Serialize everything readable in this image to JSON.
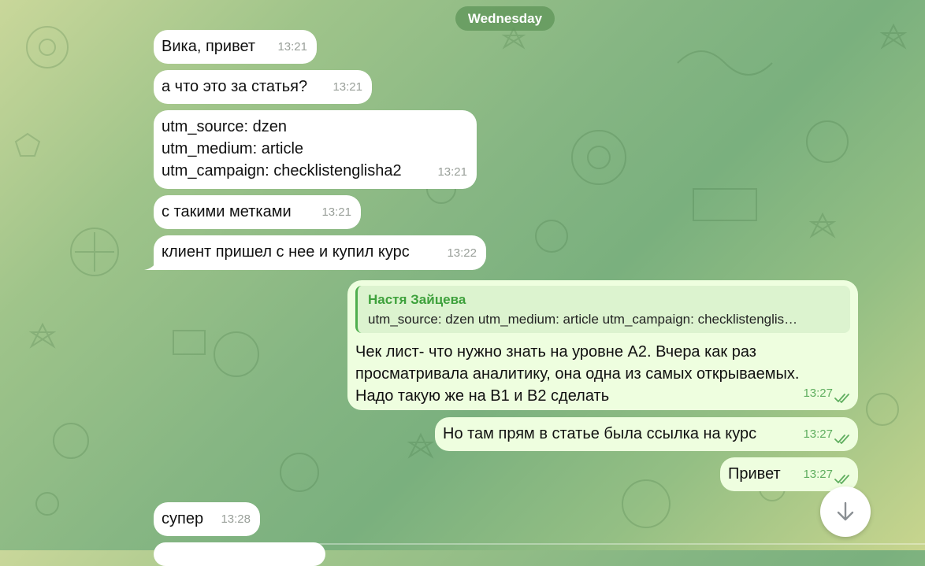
{
  "date_label": "Wednesday",
  "messages": [
    {
      "text": "Вика, привет",
      "time": "13:21"
    },
    {
      "text": "а что это за статья?",
      "time": "13:21"
    },
    {
      "text": "utm_source: dzen\nutm_medium: article\nutm_campaign: checklistenglisha2",
      "time": "13:21"
    },
    {
      "text": "с такими метками",
      "time": "13:21"
    },
    {
      "text": "клиент пришел с нее и купил курс",
      "time": "13:22"
    },
    {
      "reply_name": "Настя Зайцева",
      "reply_text": "utm_source: dzen utm_medium: article utm_campaign: checklistenglis…",
      "text": "Чек лист- что нужно знать на уровне А2. Вчера как раз\nпросматривала аналитику, она одна из самых открываемых.\nНадо такую же на В1 и В2 сделать",
      "time": "13:27"
    },
    {
      "text": "Но там прям в статье была ссылка на курс",
      "time": "13:27"
    },
    {
      "text": "Привет",
      "time": "13:27"
    },
    {
      "text": "супер",
      "time": "13:28"
    }
  ],
  "icons": {
    "scroll_down": "arrow-down-icon",
    "read_receipt": "double-check-icon"
  },
  "colors": {
    "incoming_bubble": "#ffffff",
    "outgoing_bubble": "#eefedf",
    "accent_green": "#4fae4e"
  }
}
